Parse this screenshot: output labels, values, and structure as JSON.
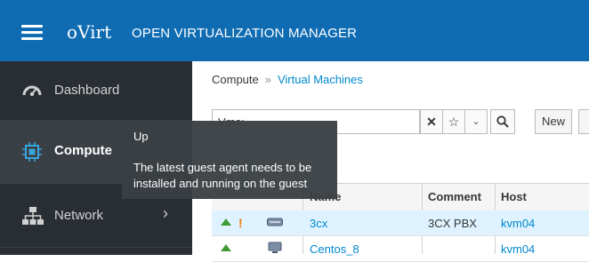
{
  "header": {
    "brand": "oVirt",
    "product": "OPEN VIRTUALIZATION MANAGER",
    "colors": {
      "header_bg": "#0f6cb2",
      "sidebar_bg": "#292e34"
    }
  },
  "sidebar": {
    "items": [
      {
        "label": "Dashboard",
        "icon": "dashboard-gauge-icon"
      },
      {
        "label": "Compute",
        "icon": "cpu-chip-icon",
        "active": true
      },
      {
        "label": "Network",
        "icon": "network-tree-icon"
      }
    ]
  },
  "breadcrumb": {
    "root": "Compute",
    "separator": "»",
    "current": "Virtual Machines"
  },
  "search": {
    "value": "Vms:"
  },
  "toolbar": {
    "new_label": "New"
  },
  "table": {
    "columns": [
      "Name",
      "Comment",
      "Host"
    ],
    "rows": [
      {
        "status": "up",
        "warning": "!",
        "name": "3cx",
        "comment": "3CX PBX",
        "host": "kvm04"
      },
      {
        "status": "up",
        "name": "Centos_8",
        "comment": "",
        "host": "kvm04"
      }
    ]
  },
  "tooltip": {
    "title": "Up",
    "body": "The latest guest agent needs to be installed and running on the guest"
  }
}
